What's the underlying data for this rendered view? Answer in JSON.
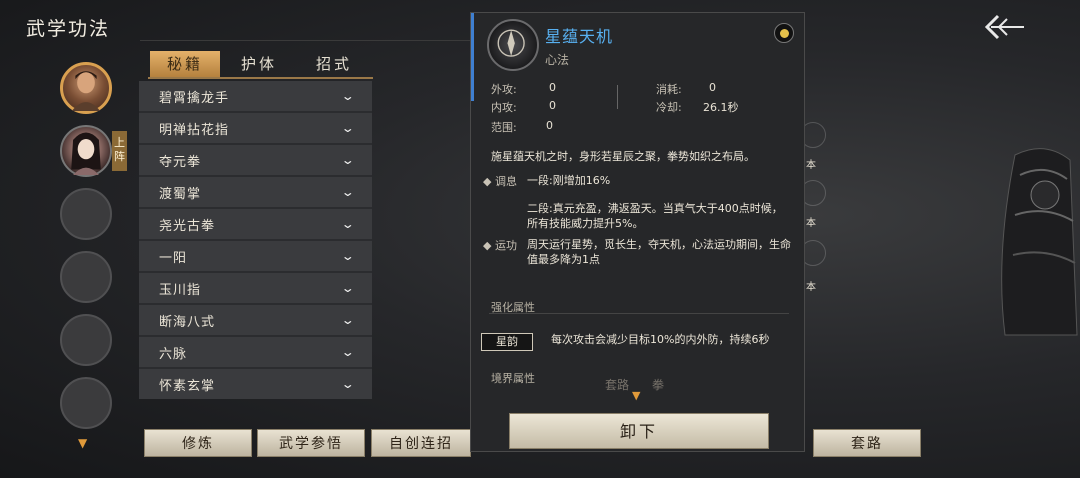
{
  "header": {
    "title": "武学功法"
  },
  "sidebar": {
    "deploy_label": "上\n阵"
  },
  "tabs": [
    "秘籍",
    "护体",
    "招式"
  ],
  "list": [
    "碧霄擒龙手",
    "明禅拈花指",
    "夺元拳",
    "渡蜀掌",
    "尧光古拳",
    "一阳",
    "玉川指",
    "断海八式",
    "六脉",
    "怀素玄掌"
  ],
  "bottom_buttons": {
    "train": "修炼",
    "insight": "武学参悟",
    "combo": "自创连招",
    "routine": "套路"
  },
  "detail": {
    "name": "星蕴天机",
    "type": "心法",
    "stats": {
      "outer_atk_label": "外攻:",
      "outer_atk": "0",
      "inner_atk_label": "内攻:",
      "inner_atk": "0",
      "range_label": "范围:",
      "range": "0",
      "cost_label": "消耗:",
      "cost": "0",
      "cooldown_label": "冷却:",
      "cooldown": "26.1秒"
    },
    "description": "施星蕴天机之时，身形若星辰之聚，拳势如织之布局。",
    "tune_label": "调息",
    "tune_text1": "一段:刚增加16%",
    "tune_text2": "二段:真元充盈，沸返盈天。当真气大于400点时候，所有技能威力提升5%。",
    "run_label": "运功",
    "run_text": "周天运行星势，觅长生，夺天机，心法运功期间，生命值最多降为1点",
    "enhance_label": "强化属性",
    "badge": "星韵",
    "enhance_text": "每次攻击会减少目标10%的内外防，持续6秒",
    "realm_label": "境界属性",
    "unequip": "卸下"
  },
  "decor": {
    "label1": "本",
    "label2": "本",
    "label3": "本",
    "label4": "套路",
    "label5": "拳"
  },
  "colors": {
    "accent_gold": "#e4b16a",
    "skill_blue": "#58b0f0",
    "panel_bg": "#262729"
  }
}
